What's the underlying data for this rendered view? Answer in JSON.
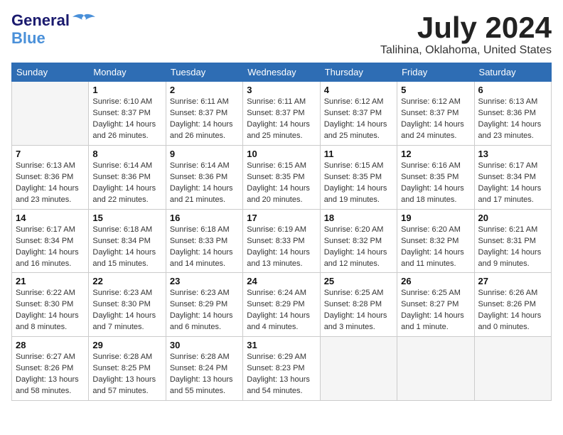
{
  "header": {
    "logo_line1": "General",
    "logo_line2": "Blue",
    "month_year": "July 2024",
    "location": "Talihina, Oklahoma, United States"
  },
  "days_of_week": [
    "Sunday",
    "Monday",
    "Tuesday",
    "Wednesday",
    "Thursday",
    "Friday",
    "Saturday"
  ],
  "weeks": [
    [
      {
        "day": "",
        "info": ""
      },
      {
        "day": "1",
        "info": "Sunrise: 6:10 AM\nSunset: 8:37 PM\nDaylight: 14 hours\nand 26 minutes."
      },
      {
        "day": "2",
        "info": "Sunrise: 6:11 AM\nSunset: 8:37 PM\nDaylight: 14 hours\nand 26 minutes."
      },
      {
        "day": "3",
        "info": "Sunrise: 6:11 AM\nSunset: 8:37 PM\nDaylight: 14 hours\nand 25 minutes."
      },
      {
        "day": "4",
        "info": "Sunrise: 6:12 AM\nSunset: 8:37 PM\nDaylight: 14 hours\nand 25 minutes."
      },
      {
        "day": "5",
        "info": "Sunrise: 6:12 AM\nSunset: 8:37 PM\nDaylight: 14 hours\nand 24 minutes."
      },
      {
        "day": "6",
        "info": "Sunrise: 6:13 AM\nSunset: 8:36 PM\nDaylight: 14 hours\nand 23 minutes."
      }
    ],
    [
      {
        "day": "7",
        "info": "Sunrise: 6:13 AM\nSunset: 8:36 PM\nDaylight: 14 hours\nand 23 minutes."
      },
      {
        "day": "8",
        "info": "Sunrise: 6:14 AM\nSunset: 8:36 PM\nDaylight: 14 hours\nand 22 minutes."
      },
      {
        "day": "9",
        "info": "Sunrise: 6:14 AM\nSunset: 8:36 PM\nDaylight: 14 hours\nand 21 minutes."
      },
      {
        "day": "10",
        "info": "Sunrise: 6:15 AM\nSunset: 8:35 PM\nDaylight: 14 hours\nand 20 minutes."
      },
      {
        "day": "11",
        "info": "Sunrise: 6:15 AM\nSunset: 8:35 PM\nDaylight: 14 hours\nand 19 minutes."
      },
      {
        "day": "12",
        "info": "Sunrise: 6:16 AM\nSunset: 8:35 PM\nDaylight: 14 hours\nand 18 minutes."
      },
      {
        "day": "13",
        "info": "Sunrise: 6:17 AM\nSunset: 8:34 PM\nDaylight: 14 hours\nand 17 minutes."
      }
    ],
    [
      {
        "day": "14",
        "info": "Sunrise: 6:17 AM\nSunset: 8:34 PM\nDaylight: 14 hours\nand 16 minutes."
      },
      {
        "day": "15",
        "info": "Sunrise: 6:18 AM\nSunset: 8:34 PM\nDaylight: 14 hours\nand 15 minutes."
      },
      {
        "day": "16",
        "info": "Sunrise: 6:18 AM\nSunset: 8:33 PM\nDaylight: 14 hours\nand 14 minutes."
      },
      {
        "day": "17",
        "info": "Sunrise: 6:19 AM\nSunset: 8:33 PM\nDaylight: 14 hours\nand 13 minutes."
      },
      {
        "day": "18",
        "info": "Sunrise: 6:20 AM\nSunset: 8:32 PM\nDaylight: 14 hours\nand 12 minutes."
      },
      {
        "day": "19",
        "info": "Sunrise: 6:20 AM\nSunset: 8:32 PM\nDaylight: 14 hours\nand 11 minutes."
      },
      {
        "day": "20",
        "info": "Sunrise: 6:21 AM\nSunset: 8:31 PM\nDaylight: 14 hours\nand 9 minutes."
      }
    ],
    [
      {
        "day": "21",
        "info": "Sunrise: 6:22 AM\nSunset: 8:30 PM\nDaylight: 14 hours\nand 8 minutes."
      },
      {
        "day": "22",
        "info": "Sunrise: 6:23 AM\nSunset: 8:30 PM\nDaylight: 14 hours\nand 7 minutes."
      },
      {
        "day": "23",
        "info": "Sunrise: 6:23 AM\nSunset: 8:29 PM\nDaylight: 14 hours\nand 6 minutes."
      },
      {
        "day": "24",
        "info": "Sunrise: 6:24 AM\nSunset: 8:29 PM\nDaylight: 14 hours\nand 4 minutes."
      },
      {
        "day": "25",
        "info": "Sunrise: 6:25 AM\nSunset: 8:28 PM\nDaylight: 14 hours\nand 3 minutes."
      },
      {
        "day": "26",
        "info": "Sunrise: 6:25 AM\nSunset: 8:27 PM\nDaylight: 14 hours\nand 1 minute."
      },
      {
        "day": "27",
        "info": "Sunrise: 6:26 AM\nSunset: 8:26 PM\nDaylight: 14 hours\nand 0 minutes."
      }
    ],
    [
      {
        "day": "28",
        "info": "Sunrise: 6:27 AM\nSunset: 8:26 PM\nDaylight: 13 hours\nand 58 minutes."
      },
      {
        "day": "29",
        "info": "Sunrise: 6:28 AM\nSunset: 8:25 PM\nDaylight: 13 hours\nand 57 minutes."
      },
      {
        "day": "30",
        "info": "Sunrise: 6:28 AM\nSunset: 8:24 PM\nDaylight: 13 hours\nand 55 minutes."
      },
      {
        "day": "31",
        "info": "Sunrise: 6:29 AM\nSunset: 8:23 PM\nDaylight: 13 hours\nand 54 minutes."
      },
      {
        "day": "",
        "info": ""
      },
      {
        "day": "",
        "info": ""
      },
      {
        "day": "",
        "info": ""
      }
    ]
  ]
}
